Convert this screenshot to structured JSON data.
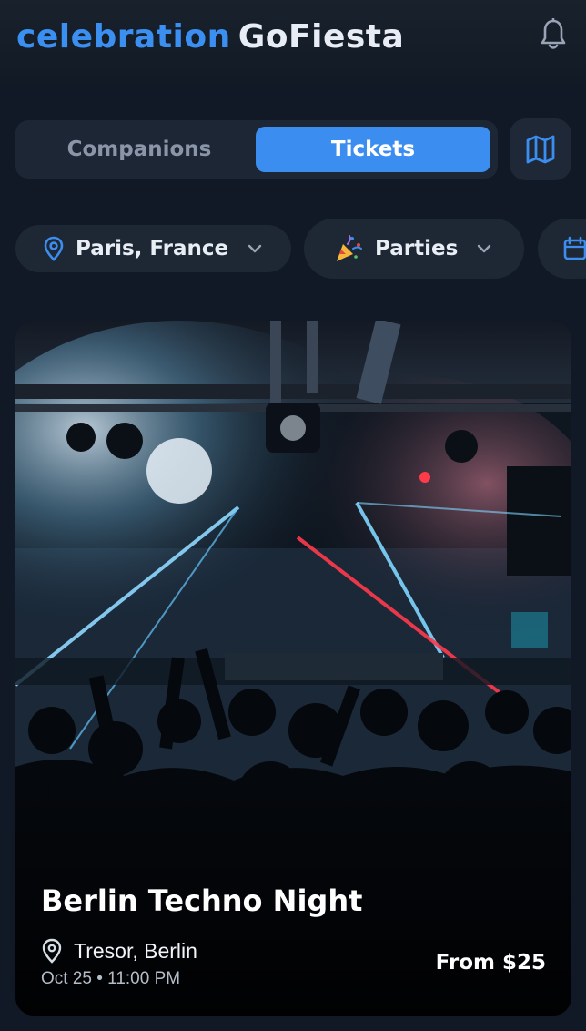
{
  "header": {
    "logo_ligature": "celebration",
    "app_name": "GoFiesta",
    "notifications_icon": "bell-icon"
  },
  "tabs": [
    {
      "label": "Companions",
      "active": false
    },
    {
      "label": "Tickets",
      "active": true
    }
  ],
  "map_button_icon": "map-icon",
  "filters": {
    "location": {
      "label": "Paris, France",
      "icon": "map-pin-icon"
    },
    "category": {
      "label": "Parties",
      "icon": "party-popper-icon"
    },
    "date": {
      "icon": "calendar-icon"
    }
  },
  "event": {
    "title": "Berlin Techno Night",
    "venue": "Tresor, Berlin",
    "datetime": "Oct 25 • 11:00 PM",
    "price": "From $25"
  },
  "colors": {
    "accent": "#3b8ef0",
    "background": "#111926",
    "surface": "#1e2835"
  }
}
